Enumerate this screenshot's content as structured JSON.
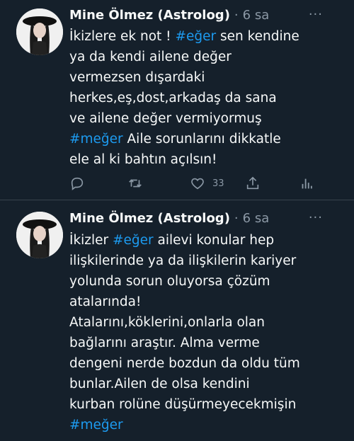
{
  "tweets": [
    {
      "author": "Mine Ölmez (Astrolog)",
      "separator": "·",
      "time": "6 sa",
      "more": "···",
      "lines": [
        [
          {
            "t": "İkizlere ek not ! "
          },
          {
            "t": "#eğer",
            "tag": true
          },
          {
            "t": " sen kendine"
          }
        ],
        [
          {
            "t": "ya da kendi ailene değer"
          }
        ],
        [
          {
            "t": "vermezsen dışardaki"
          }
        ],
        [
          {
            "t": "herkes,eş,dost,arkadaş da sana"
          }
        ],
        [
          {
            "t": "ve ailene değer vermiyormuş"
          }
        ],
        [
          {
            "t": "#meğer",
            "tag": true
          },
          {
            "t": " Aile sorunlarını dikkatle"
          }
        ],
        [
          {
            "t": "ele al ki bahtın açılsın!"
          }
        ]
      ],
      "actions": {
        "reply_icon": "reply-icon",
        "retweet_icon": "retweet-icon",
        "like_icon": "heart-icon",
        "like_count": "33",
        "share_icon": "share-icon",
        "analytics_icon": "analytics-icon"
      }
    },
    {
      "author": "Mine Ölmez (Astrolog)",
      "separator": "·",
      "time": "6 sa",
      "more": "···",
      "lines": [
        [
          {
            "t": "İkizler "
          },
          {
            "t": "#eğer",
            "tag": true
          },
          {
            "t": " ailevi konular hep"
          }
        ],
        [
          {
            "t": "ilişkilerinde ya da ilişkilerin kariyer"
          }
        ],
        [
          {
            "t": "yolunda sorun oluyorsa çözüm"
          }
        ],
        [
          {
            "t": "atalarında!"
          }
        ],
        [
          {
            "t": "Atalarını,köklerini,onlarla olan"
          }
        ],
        [
          {
            "t": "bağlarını araştır. Alma verme"
          }
        ],
        [
          {
            "t": "dengeni nerde bozdun da oldu tüm"
          }
        ],
        [
          {
            "t": "bunlar.Ailen de olsa kendini"
          }
        ],
        [
          {
            "t": "kurban rolüne düşürmeyecekmişin"
          }
        ],
        [
          {
            "t": "#meğer",
            "tag": true
          }
        ]
      ]
    }
  ],
  "colors": {
    "background": "#15202b",
    "text": "#f7f9f9",
    "muted": "#8b98a5",
    "hashtag": "#1d9bf0",
    "divider": "#38444d"
  }
}
